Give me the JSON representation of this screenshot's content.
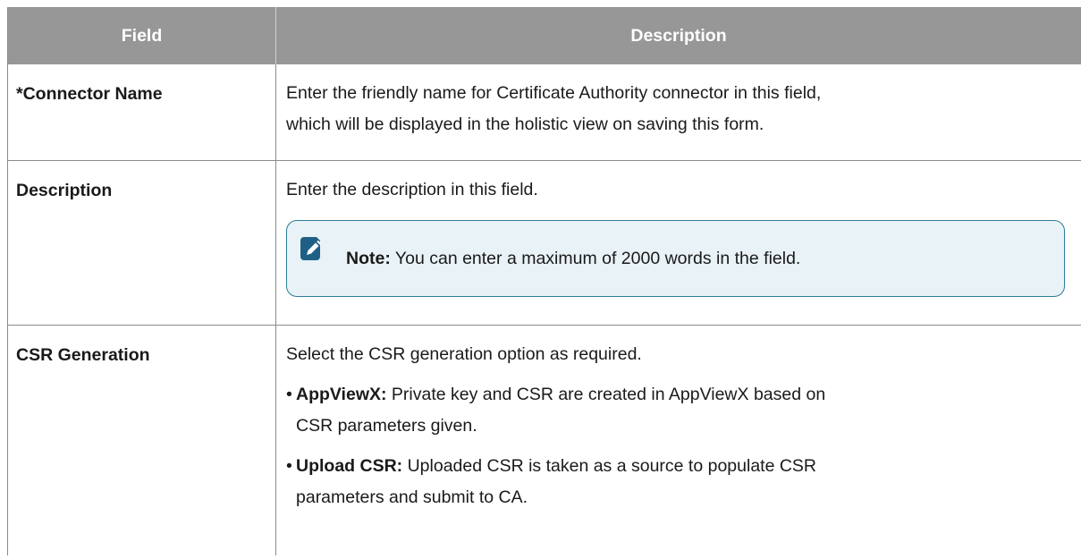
{
  "table": {
    "headers": {
      "field": "Field",
      "description": "Description"
    },
    "rows": [
      {
        "field": "*Connector Name",
        "description_lines": [
          "Enter the friendly name for Certificate Authority connector in this field,",
          "which will be displayed in the holistic view on saving this form."
        ]
      },
      {
        "field": "Description",
        "description_lines": [
          "Enter the description in this field."
        ],
        "note": {
          "icon": "pencil-note-icon",
          "label": "Note:",
          "text": " You can enter a maximum of 2000 words in the field."
        }
      },
      {
        "field": "CSR Generation",
        "description_lines": [
          "Select the CSR generation option as required."
        ],
        "bullets": [
          {
            "label": "AppViewX:",
            "line1": " Private key and CSR are created in AppViewX based on",
            "line2": "CSR parameters given."
          },
          {
            "label": "Upload CSR:",
            "line1": " Uploaded CSR is taken as a source to populate CSR",
            "line2": "parameters and submit to CA."
          }
        ]
      }
    ]
  },
  "colors": {
    "header_bg": "#979797",
    "note_border": "#2f7d9a",
    "note_bg": "#e9f2f6",
    "note_icon": "#1f5f86"
  }
}
